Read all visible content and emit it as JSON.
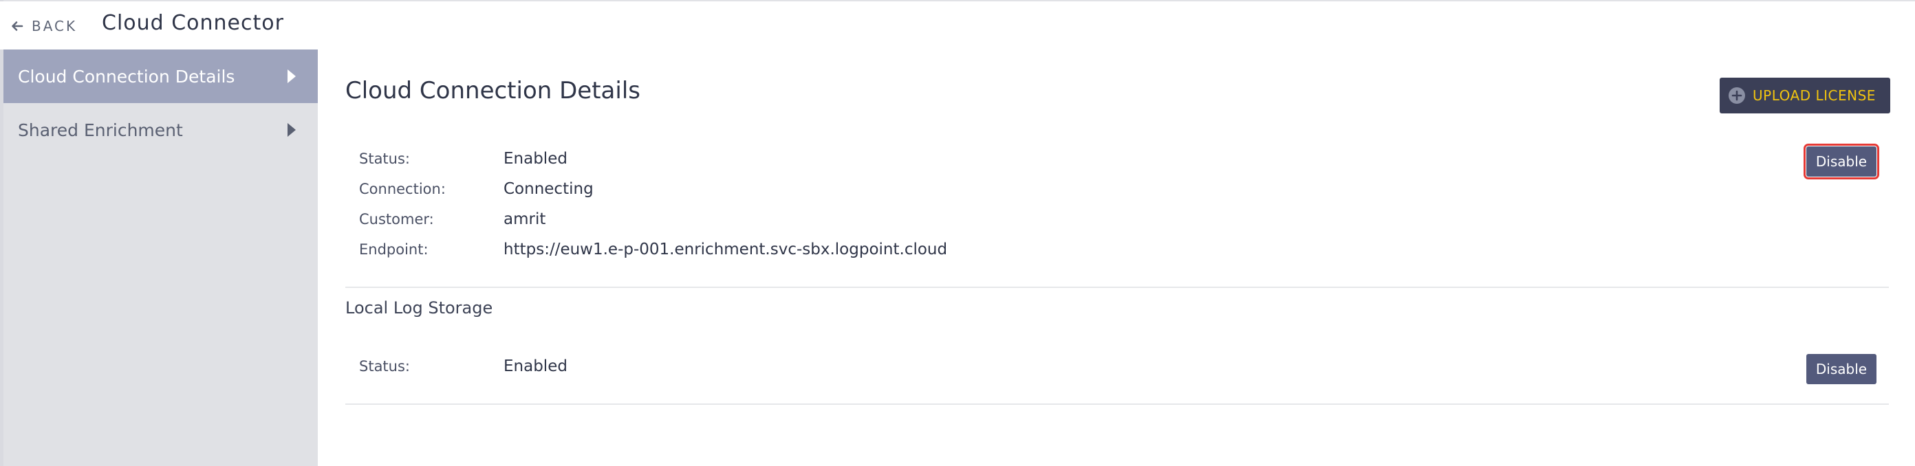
{
  "header": {
    "back_label": "BACK",
    "title": "Cloud Connector"
  },
  "sidebar": {
    "items": [
      {
        "label": "Cloud Connection Details",
        "active": true
      },
      {
        "label": "Shared Enrichment",
        "active": false
      }
    ]
  },
  "main": {
    "title": "Cloud Connection Details",
    "upload_button": "UPLOAD LICENSE",
    "details": {
      "status_label": "Status:",
      "status_value": "Enabled",
      "connection_label": "Connection:",
      "connection_value": "Connecting",
      "customer_label": "Customer:",
      "customer_value": "amrit",
      "endpoint_label": "Endpoint:",
      "endpoint_value": "https://euw1.e-p-001.enrichment.svc-sbx.logpoint.cloud",
      "disable_button": "Disable"
    },
    "local_log_storage": {
      "title": "Local Log Storage",
      "status_label": "Status:",
      "status_value": "Enabled",
      "disable_button": "Disable"
    }
  },
  "colors": {
    "sidebar_active": "#9ea4bd",
    "sidebar_bg": "#e0e1e5",
    "button_dark": "#3b3f57",
    "button_disable": "#535a7c",
    "upload_text": "#f1c40f",
    "focus_outline": "#e53935"
  },
  "icons": {
    "back": "arrow-left-icon",
    "upload": "plus-circle-icon",
    "sidebar_item": "caret-right-icon"
  }
}
